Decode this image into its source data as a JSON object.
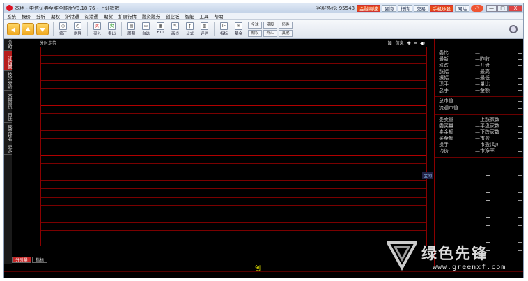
{
  "titlebar": {
    "title": "本地 - 中信证券至胜全能版V8.18.76 - 上证指数",
    "hotline": "客服热线: 95548",
    "buttons": [
      "金融商城",
      "咨询",
      "行情",
      "交易",
      "手机炒股",
      "网站"
    ],
    "badge": "八",
    "min": "—",
    "max": "□",
    "close": "X"
  },
  "menu": [
    "系统",
    "报价",
    "分析",
    "期权",
    "沪港通",
    "深港通",
    "期货",
    "扩展行情",
    "融资融券",
    "创业板",
    "智能",
    "工具",
    "帮助"
  ],
  "toolbar": {
    "tools": [
      {
        "label": "修正",
        "icon": "◎"
      },
      {
        "label": "刷屏",
        "icon": "◷"
      },
      {
        "label": "买入",
        "icon": "买"
      },
      {
        "label": "卖出",
        "icon": "卖"
      },
      {
        "label": "周期",
        "icon": "▤"
      },
      {
        "label": "自选",
        "icon": "▭"
      },
      {
        "label": "F10",
        "icon": "▦"
      },
      {
        "label": "画线",
        "icon": "✎"
      },
      {
        "label": "公式",
        "icon": "ƒ"
      },
      {
        "label": "评估",
        "icon": "▥"
      },
      {
        "label": "指标",
        "icon": "IF"
      },
      {
        "label": "基金",
        "icon": "✉"
      }
    ],
    "mini": [
      "全球",
      "港股",
      "债券",
      "期权",
      "外汇",
      "其他"
    ]
  },
  "side_tabs": [
    {
      "label": "分时",
      "active": false
    },
    {
      "label": "上证指数",
      "active": true
    },
    {
      "label": "技术分析",
      "active": false
    },
    {
      "label": "大盘资讯",
      "active": false
    },
    {
      "label": "自选",
      "active": false
    },
    {
      "label": "成交排名",
      "active": false
    },
    {
      "label": "更多",
      "active": false
    }
  ],
  "chart": {
    "header_label": "分时走势",
    "controls": [
      "加",
      "信息",
      "✚",
      "━",
      "◀)"
    ],
    "zone_tag": "区间"
  },
  "bottom_tabs": [
    {
      "label": "分时量",
      "active": true
    },
    {
      "label": "指标",
      "active": false
    }
  ],
  "status": {
    "mark": "创"
  },
  "right_panel": {
    "rows_top": [
      {
        "k": "委比",
        "v": "—"
      },
      {
        "k": "最新",
        "v": "—昨收"
      },
      {
        "k": "涨跌",
        "v": "—开盘"
      },
      {
        "k": "涨幅",
        "v": "—最高"
      },
      {
        "k": "振幅",
        "v": "—最低"
      },
      {
        "k": "现手",
        "v": "—量比"
      },
      {
        "k": "总手",
        "v": "—金额"
      }
    ],
    "rows_mid": [
      {
        "k": "总市值",
        "v": ""
      },
      {
        "k": "流通市值",
        "v": ""
      }
    ],
    "rows_bottom": [
      {
        "k": "委卖量",
        "v": "—上涨家数"
      },
      {
        "k": "委买量",
        "v": "—平盘家数"
      },
      {
        "k": "卖金额",
        "v": "—下跌家数"
      },
      {
        "k": "买金额",
        "v": "—市盈"
      },
      {
        "k": "换手",
        "v": "—市盈(动)"
      },
      {
        "k": "均价",
        "v": "—市净率"
      }
    ]
  },
  "watermark": {
    "text": "绿色先锋",
    "url": "www.greenxf.com"
  }
}
